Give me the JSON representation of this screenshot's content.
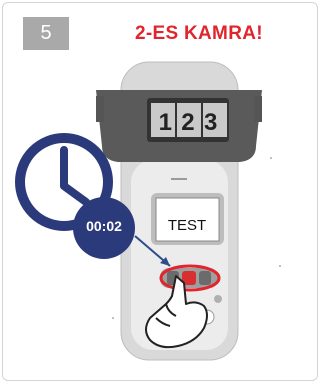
{
  "step": {
    "number": "5"
  },
  "title": "2-ES KAMRA!",
  "counter": {
    "digits": [
      "1",
      "2",
      "3"
    ]
  },
  "screen": {
    "text": "TEST"
  },
  "timer": {
    "text": "00:02"
  },
  "icons": [
    "clock-icon",
    "pointing-hand-icon"
  ],
  "colors": {
    "title": "#e0252d",
    "clock": "#2b3a7a",
    "highlight": "#e0252d",
    "badge": "#a9a9a9"
  }
}
